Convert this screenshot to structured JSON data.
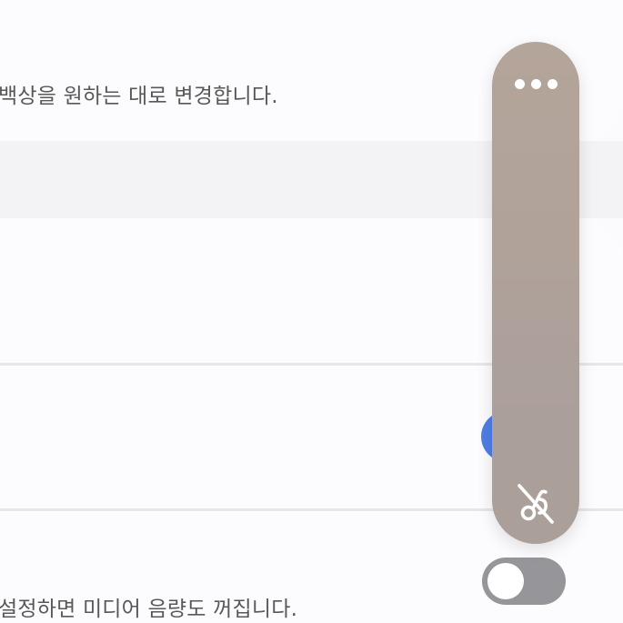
{
  "settings": {
    "top_description": "백상을 원하는 대로 변경합니다.",
    "bottom_description": "설정하면 미디어 음량도 꺼집니다."
  },
  "toggles": [
    {
      "name": "setting-toggle-1",
      "state": "on",
      "color": "#4e7ee6"
    },
    {
      "name": "setting-toggle-2",
      "state": "off",
      "color": "#96969a"
    }
  ],
  "volume_panel": {
    "more_icon": "more-horizontal-icon",
    "mute_icon": "vibrate-off-icon",
    "colors": {
      "panel_top": "#b4a59b",
      "panel_bottom": "#ab9f99",
      "icon": "#ffffff"
    }
  }
}
